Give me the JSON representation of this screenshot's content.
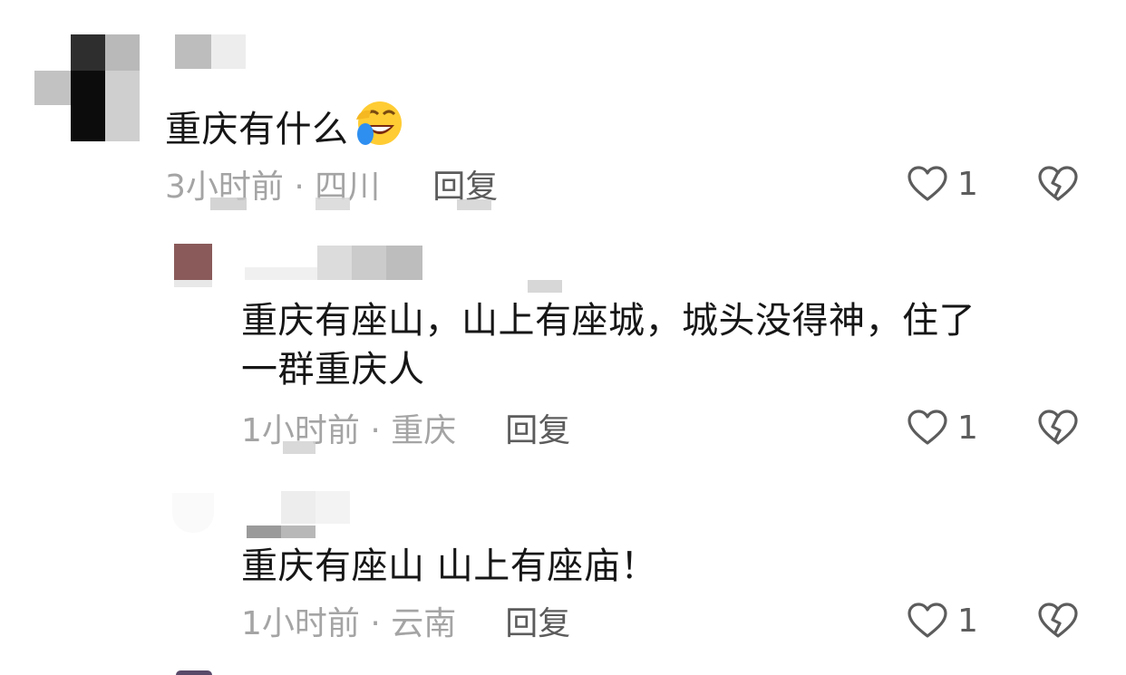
{
  "comments": [
    {
      "text": "重庆有什么",
      "emoji": "laughing-crying-emoji",
      "time": "3小时前 · 四川",
      "reply_label": "回复",
      "likes": "1"
    },
    {
      "text_line1": "重庆有座山，山上有座城，城头没得神，住了",
      "text_line2": "一群重庆人",
      "time": "1小时前 · 重庆",
      "reply_label": "回复",
      "likes": "1"
    },
    {
      "text": "重庆有座山 山上有座庙！",
      "time": "1小时前 · 云南",
      "reply_label": "回复",
      "likes": "1"
    }
  ],
  "icons": {
    "like": "heart-outline-icon",
    "dislike": "broken-heart-icon"
  },
  "colors": {
    "text": "#161616",
    "meta": "#a4a4a4",
    "action": "#5c5c5c"
  }
}
